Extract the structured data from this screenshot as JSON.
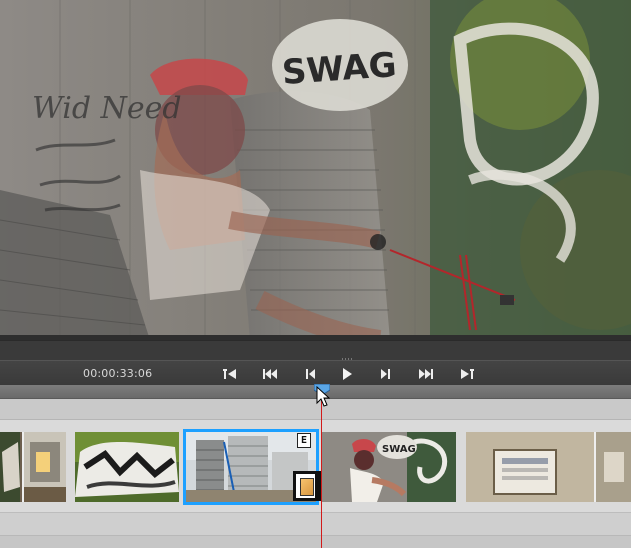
{
  "preview": {
    "graffiti_text": "SWAG",
    "wall_text": "Wid Need"
  },
  "transport": {
    "timecode": "00:00:33:06",
    "buttons": [
      {
        "name": "go-to-in-point-button",
        "icon": "go-to-in-icon"
      },
      {
        "name": "previous-edit-button",
        "icon": "previous-edit-icon"
      },
      {
        "name": "step-back-button",
        "icon": "step-back-icon"
      },
      {
        "name": "play-button",
        "icon": "play-icon"
      },
      {
        "name": "step-forward-button",
        "icon": "step-forward-icon"
      },
      {
        "name": "next-edit-button",
        "icon": "next-edit-icon"
      },
      {
        "name": "go-to-out-point-button",
        "icon": "go-to-out-icon"
      }
    ]
  },
  "timeline": {
    "selected_clip_badge": "E",
    "colors": {
      "selection": "#1da0ff",
      "playhead": "#d21a1a",
      "playhead_handle": "#5aa6e6"
    }
  }
}
